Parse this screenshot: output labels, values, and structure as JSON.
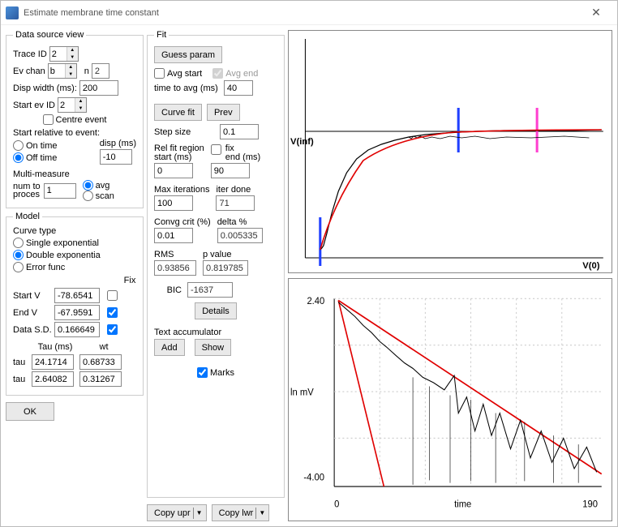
{
  "window": {
    "title": "Estimate membrane time constant"
  },
  "dataSource": {
    "legend": "Data source view",
    "traceIdLabel": "Trace ID",
    "traceId": "2",
    "evChanLabel": "Ev chan",
    "evChan": "b",
    "nLabel": "n",
    "n": "2",
    "dispWidthLabel": "Disp width  (ms):",
    "dispWidth": "200",
    "startEvIdLabel": "Start ev ID",
    "startEvId": "2",
    "centreLabel": "Centre event",
    "startRelLabel": "Start relative to event:",
    "onTimeLabel": "On time",
    "offTimeLabel": "Off time",
    "dispMsLabel": "disp (ms)",
    "dispMs": "-10",
    "multiLabel": "Multi-measure",
    "numToProcLabel1": "num to",
    "numToProcLabel2": "proces",
    "numToProc": "1",
    "avgLabel": "avg",
    "scanLabel": "scan"
  },
  "model": {
    "legend": "Model",
    "curveTypeLabel": "Curve type",
    "singleExpLabel": "Single exponential",
    "doubleExpLabel": "Double exponentia",
    "errorFuncLabel": "Error func",
    "fixLabel": "Fix",
    "startVLabel": "Start V",
    "startV": "-78.6541",
    "endVLabel": "End V",
    "endV": "-67.9591",
    "dataSDLabel": "Data S.D.",
    "dataSD": "0.166649",
    "tauMsLabel": "Tau (ms)",
    "wtLabel": "wt",
    "tauLabel": "tau",
    "tau1": "24.1714",
    "wt1": "0.68733",
    "tau2": "2.64082",
    "wt2": "0.31267"
  },
  "fit": {
    "legend": "Fit",
    "guessParam": "Guess param",
    "avgStartLabel": "Avg start",
    "avgEndLabel": "Avg end",
    "timeToAvgLabel": "time to avg (ms)",
    "timeToAvg": "40",
    "curveFit": "Curve fit",
    "prev": "Prev",
    "stepSizeLabel": "Step size",
    "stepSize": "0.1",
    "relFitLabel1": "Rel fit region",
    "relFitLabel2": "start (ms)",
    "relFitStart": "0",
    "fixEndLabel": "fix\nend (ms)",
    "fixEnd": "90",
    "fixEndLbl1": "fix",
    "fixEndLbl2": "end (ms)",
    "maxIterLabel": "Max iterations",
    "maxIter": "100",
    "iterDoneLabel": "iter done",
    "iterDone": "71",
    "convgCritLabel": "Convg crit (%)",
    "convgCrit": "0.01",
    "deltaLabel": "delta %",
    "delta": "0.005335",
    "rmsLabel": "RMS",
    "rms": "0.93856",
    "pvalLabel": "p value",
    "pval": "0.819785",
    "bicLabel": "BIC",
    "bic": "-1637",
    "details": "Details",
    "textAccumLabel": "Text accumulator",
    "add": "Add",
    "show": "Show",
    "marksLabel": "Marks"
  },
  "buttons": {
    "ok": "OK",
    "copyUpr": "Copy upr",
    "copyLwr": "Copy lwr"
  },
  "chart_data": [
    {
      "type": "line",
      "title": "",
      "annotations": [
        "V(inf)",
        "V(0)"
      ],
      "marker_cursors_ms": [
        10,
        105,
        150
      ],
      "x_range_ms": [
        0,
        200
      ],
      "description": "Voltage rising from V(0) to V(inf) with double-exponential fit overlay (red curve over noisy black trace)."
    },
    {
      "type": "line",
      "xlabel": "time",
      "ylabel": "ln  mV",
      "x_ticks": [
        0,
        190
      ],
      "y_ticks": [
        -4.0,
        2.4
      ],
      "x_range": [
        0,
        190
      ],
      "y_range": [
        -4.0,
        2.4
      ],
      "description": "Log-linear peeled residual plot with two red straight-line fits (fast and slow components) over noisy black data."
    }
  ]
}
